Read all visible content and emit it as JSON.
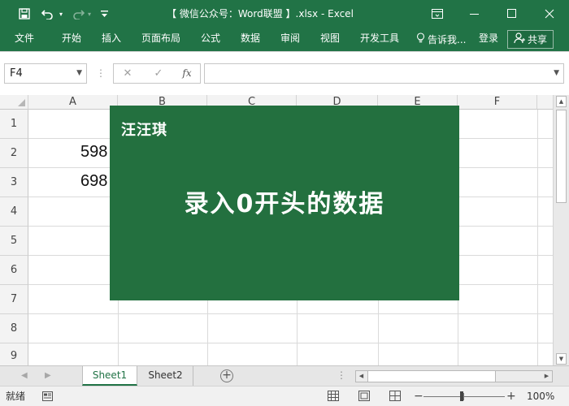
{
  "window": {
    "title": "【 微信公众号：Word联盟 】.xlsx - Excel",
    "controls": {
      "restore_icon": "ribbon-display-icon",
      "minimize": "minimize-icon",
      "maximize": "maximize-icon",
      "close": "close-icon"
    }
  },
  "quick_access": {
    "save_icon": "save-icon",
    "undo_icon": "undo-icon",
    "redo_icon": "redo-icon",
    "customize_icon": "customize-icon"
  },
  "menu": {
    "tabs": [
      "文件",
      "开始",
      "插入",
      "页面布局",
      "公式",
      "数据",
      "审阅",
      "视图",
      "开发工具"
    ],
    "tell_me": "告诉我...",
    "login": "登录",
    "share": "共享"
  },
  "formula_bar": {
    "name_box": "F4",
    "cancel_symbol": "✕",
    "confirm_symbol": "✓",
    "fx_label": "fx",
    "formula_value": ""
  },
  "sheet": {
    "columns": [
      "A",
      "B",
      "C",
      "D",
      "E",
      "F"
    ],
    "rows": [
      "1",
      "2",
      "3",
      "4",
      "5",
      "6",
      "7",
      "8",
      "9"
    ],
    "cells": {
      "A2": "598",
      "A3": "698"
    }
  },
  "overlay": {
    "brand": "汪汪琪",
    "title": "录入0开头的数据",
    "background": "#23703f"
  },
  "sheet_tabs": {
    "tabs": [
      "Sheet1",
      "Sheet2"
    ],
    "active": "Sheet1",
    "add_symbol": "+"
  },
  "status_bar": {
    "ready_text": "就绪",
    "zoom_minus": "−",
    "zoom_plus": "+",
    "zoom_level": "100%"
  },
  "colors": {
    "accent": "#217346",
    "card": "#23703f"
  }
}
